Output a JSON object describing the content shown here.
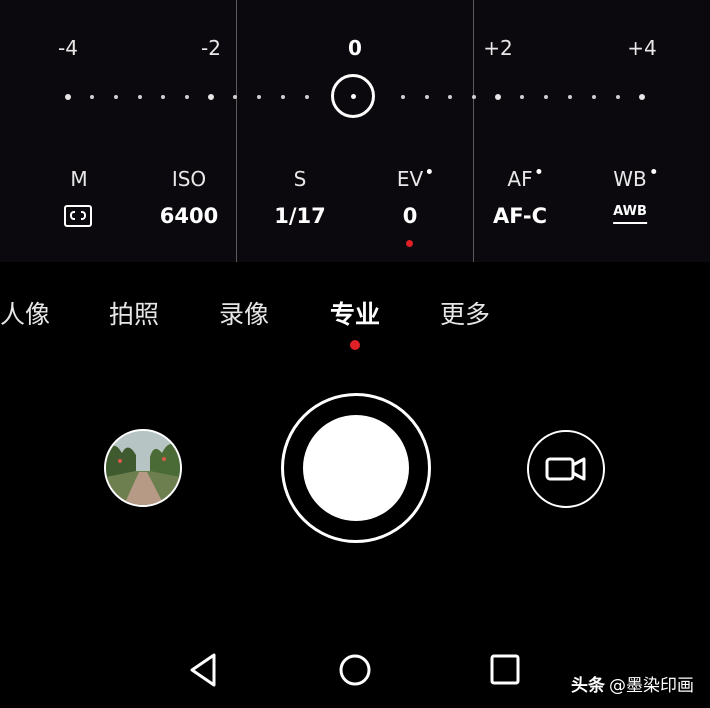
{
  "ev_scale": {
    "labels": [
      "-4",
      "-2",
      "0",
      "+2",
      "+4"
    ],
    "current_value": 0
  },
  "params": {
    "metering": {
      "name": "M",
      "value_icon": "matrix-metering-icon"
    },
    "iso": {
      "name": "ISO",
      "value": "6400"
    },
    "shutter": {
      "name": "S",
      "value": "1/17"
    },
    "ev": {
      "name": "EV",
      "value": "0"
    },
    "af": {
      "name": "AF",
      "value": "AF-C"
    },
    "wb": {
      "name": "WB",
      "value": "AWB"
    }
  },
  "modes": {
    "items": [
      "人像",
      "拍照",
      "录像",
      "专业",
      "更多"
    ],
    "active": "专业"
  },
  "controls": {
    "gallery_icon": "gallery-thumbnail",
    "shutter_icon": "shutter-button",
    "video_icon": "video-camera-icon"
  },
  "navbar": {
    "back_icon": "triangle-back-icon",
    "home_icon": "circle-home-icon",
    "recent_icon": "square-recents-icon"
  },
  "watermark": {
    "logo": "头条",
    "handle": "@墨染印画"
  },
  "colors": {
    "background": "#000000",
    "panel": "#0b090d",
    "accent_red": "#e02027",
    "foreground": "#ffffff"
  }
}
